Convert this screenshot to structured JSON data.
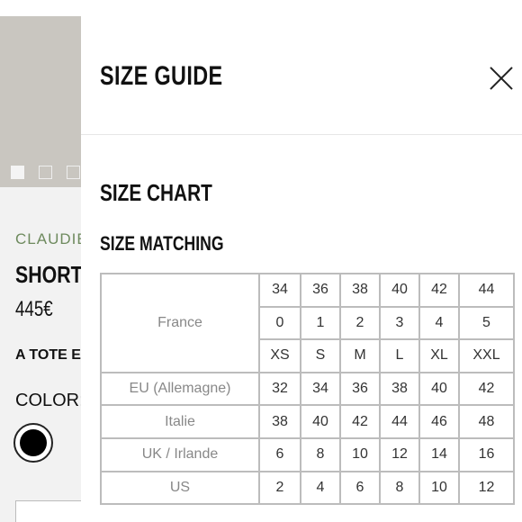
{
  "product": {
    "brand": "CLAUDIE",
    "name": "SHORT",
    "price": "445€",
    "tote": "A TOTE E",
    "color_label": "COLOR:",
    "swatch_color": "#000000"
  },
  "drawer": {
    "title": "SIZE GUIDE",
    "close_icon": "close-icon",
    "section_title": "SIZE CHART",
    "subsection_title": "SIZE MATCHING"
  },
  "size_table": {
    "france": {
      "label": "France",
      "numeric": [
        "34",
        "36",
        "38",
        "40",
        "42",
        "44"
      ],
      "index": [
        "0",
        "1",
        "2",
        "3",
        "4",
        "5"
      ],
      "letters": [
        "XS",
        "S",
        "M",
        "L",
        "XL",
        "XXL"
      ]
    },
    "rows": [
      {
        "label": "EU (Allemagne)",
        "values": [
          "32",
          "34",
          "36",
          "38",
          "40",
          "42"
        ]
      },
      {
        "label": "Italie",
        "values": [
          "38",
          "40",
          "42",
          "44",
          "46",
          "48"
        ]
      },
      {
        "label": "UK / Irlande",
        "values": [
          "6",
          "8",
          "10",
          "12",
          "14",
          "16"
        ]
      },
      {
        "label": "US",
        "values": [
          "2",
          "4",
          "6",
          "8",
          "10",
          "12"
        ]
      }
    ]
  },
  "colors": {
    "brand_green": "#6e8a5e",
    "image_placeholder": "#c9c6c0",
    "table_border": "#bcbcbc"
  }
}
